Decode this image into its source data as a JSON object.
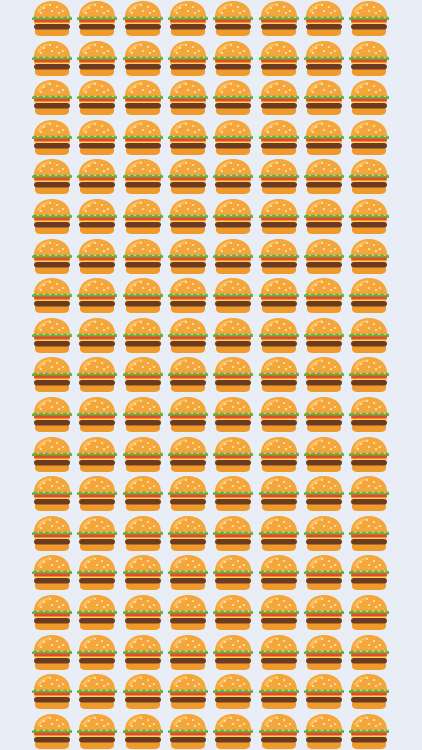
{
  "game": {
    "title": "",
    "background_color": "#e9edf6",
    "tile": {
      "icon": "hamburger-icon",
      "rows": 19,
      "columns": 8
    },
    "colors": {
      "bun": "#f4a63a",
      "bun_highlight": "#ffc463",
      "bun_bottom": "#f19a2c",
      "sesame": "#fff4d6",
      "lettuce": "#69b23a",
      "tomato": "#e5482e",
      "cheese": "#ffd34a",
      "patty": "#6a3a22",
      "outline": "#8a4f1c"
    }
  }
}
